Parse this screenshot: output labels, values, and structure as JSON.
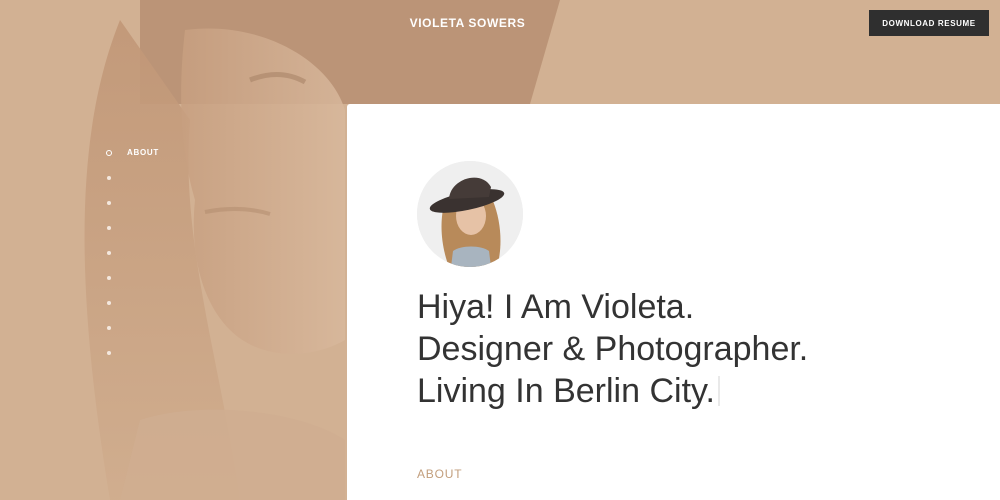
{
  "header": {
    "site_title": "VIOLETA SOWERS",
    "download_label": "DOWNLOAD RESUME"
  },
  "side_nav": {
    "items": [
      {
        "label": "ABOUT",
        "active": true
      },
      {
        "label": "",
        "active": false
      },
      {
        "label": "",
        "active": false
      },
      {
        "label": "",
        "active": false
      },
      {
        "label": "",
        "active": false
      },
      {
        "label": "",
        "active": false
      },
      {
        "label": "",
        "active": false
      },
      {
        "label": "",
        "active": false
      },
      {
        "label": "",
        "active": false
      }
    ]
  },
  "intro": {
    "line1": "Hiya! I Am Violeta.",
    "line2": "Designer & Photographer.",
    "line3": "Living In Berlin City."
  },
  "section": {
    "label": "ABOUT"
  },
  "colors": {
    "background": "#d2b193",
    "accent": "#c29e7c",
    "button": "#2f2f2f",
    "text": "#333333"
  },
  "icons": {
    "avatar": "portrait-photo"
  }
}
